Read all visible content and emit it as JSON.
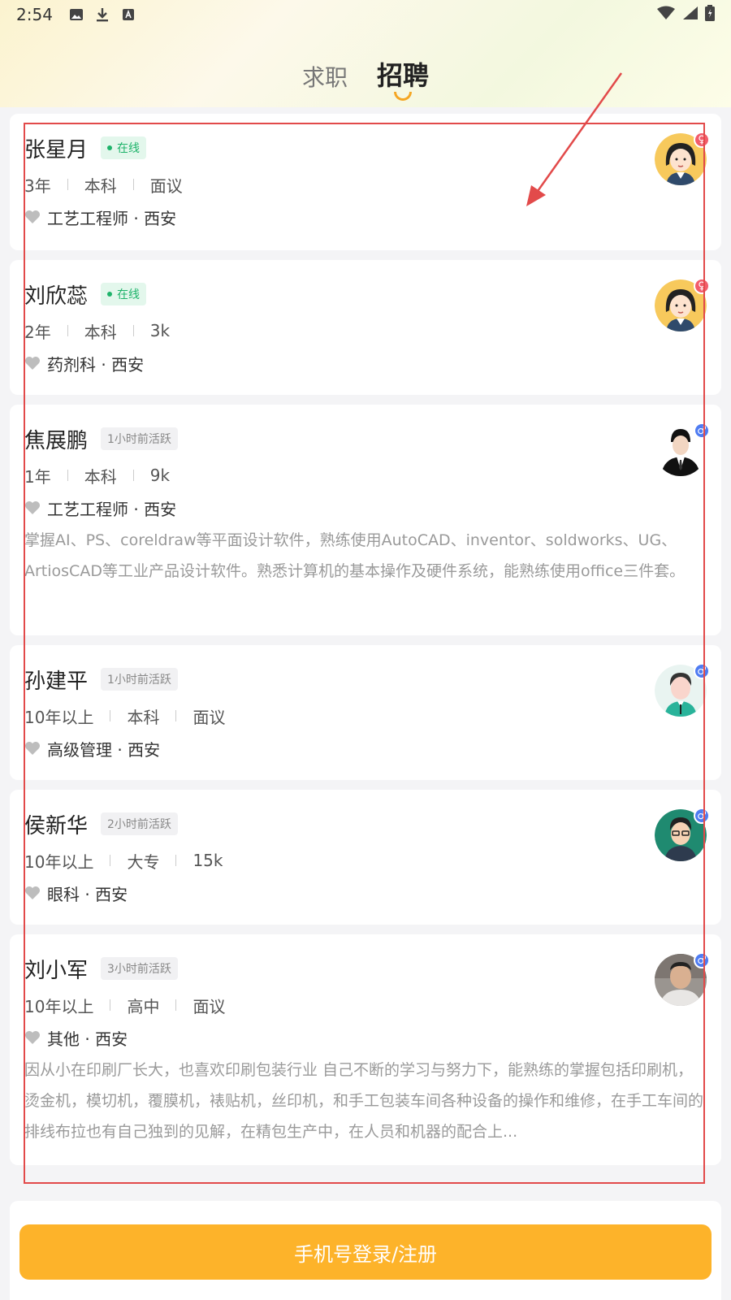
{
  "status_bar": {
    "time": "2:54",
    "icons": [
      "image-icon",
      "download-icon",
      "keyboard-icon"
    ],
    "right_icons": [
      "wifi-icon",
      "signal-icon",
      "battery-icon"
    ]
  },
  "tabs": [
    {
      "label": "求职",
      "active": false
    },
    {
      "label": "招聘",
      "active": true
    }
  ],
  "candidates": [
    {
      "name": "张星月",
      "badge": "在线",
      "online": true,
      "years": "3年",
      "edu": "本科",
      "salary": "面议",
      "job": "工艺工程师 · 西安",
      "gender": "female",
      "desc": ""
    },
    {
      "name": "刘欣蕊",
      "badge": "在线",
      "online": true,
      "years": "2年",
      "edu": "本科",
      "salary": "3k",
      "job": "药剂科 · 西安",
      "gender": "female",
      "desc": ""
    },
    {
      "name": "焦展鹏",
      "badge": "1小时前活跃",
      "online": false,
      "years": "1年",
      "edu": "本科",
      "salary": "9k",
      "job": "工艺工程师 · 西安",
      "gender": "male",
      "desc": "掌握AI、PS、coreldraw等平面设计软件，熟练使用AutoCAD、inventor、soldworks、UG、ArtiosCAD等工业产品设计软件。熟悉计算机的基本操作及硬件系统，能熟练使用office三件套。"
    },
    {
      "name": "孙建平",
      "badge": "1小时前活跃",
      "online": false,
      "years": "10年以上",
      "edu": "本科",
      "salary": "面议",
      "job": "高级管理 · 西安",
      "gender": "male",
      "desc": ""
    },
    {
      "name": "侯新华",
      "badge": "2小时前活跃",
      "online": false,
      "years": "10年以上",
      "edu": "大专",
      "salary": "15k",
      "job": "眼科 · 西安",
      "gender": "male",
      "desc": ""
    },
    {
      "name": "刘小军",
      "badge": "3小时前活跃",
      "online": false,
      "years": "10年以上",
      "edu": "高中",
      "salary": "面议",
      "job": "其他 · 西安",
      "gender": "male",
      "desc": "因从小在印刷厂长大，也喜欢印刷包装行业 自己不断的学习与努力下，能熟练的掌握包括印刷机，烫金机，模切机，覆膜机，裱贴机，丝印机，和手工包装车间各种设备的操作和维修，在手工车间的排线布拉也有自己独到的见解，在精包生产中，在人员和机器的配合上..."
    }
  ],
  "login_button": "手机号登录/注册",
  "colors": {
    "accent": "#fdb32a",
    "online": "#1eb36a",
    "highlight": "#e24a4a"
  }
}
